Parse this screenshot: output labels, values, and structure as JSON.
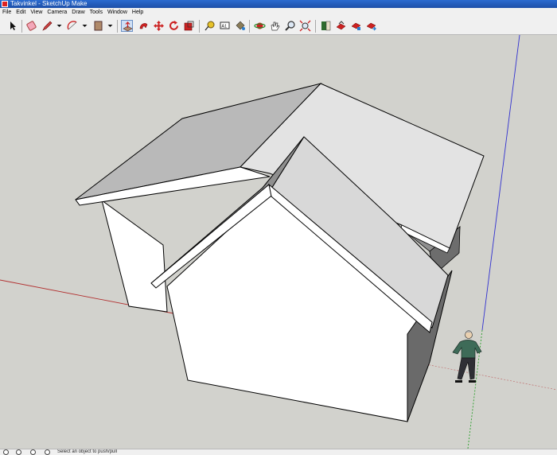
{
  "window": {
    "title": "Takvinkel - SketchUp Make"
  },
  "menu": [
    "File",
    "Edit",
    "View",
    "Camera",
    "Draw",
    "Tools",
    "Window",
    "Help"
  ],
  "toolbar": {
    "tools": [
      {
        "name": "select",
        "icon": "arrow-icon",
        "selected": false
      },
      {
        "name": "eraser",
        "icon": "eraser-icon",
        "selected": false
      },
      {
        "name": "pencil",
        "icon": "pencil-icon",
        "selected": false
      },
      {
        "name": "arc",
        "icon": "arc-icon",
        "selected": false
      },
      {
        "name": "rectangle",
        "icon": "rectangle-icon",
        "selected": false
      },
      {
        "name": "push-pull",
        "icon": "push-pull-icon",
        "selected": true
      },
      {
        "name": "follow-me",
        "icon": "follow-me-icon",
        "selected": false
      },
      {
        "name": "move",
        "icon": "move-icon",
        "selected": false
      },
      {
        "name": "rotate",
        "icon": "rotate-icon",
        "selected": false
      },
      {
        "name": "scale",
        "icon": "scale-icon",
        "selected": false
      },
      {
        "name": "tape-measure",
        "icon": "tape-measure-icon",
        "selected": false
      },
      {
        "name": "text",
        "icon": "text-icon",
        "selected": false
      },
      {
        "name": "paint-bucket",
        "icon": "paint-bucket-icon",
        "selected": false
      },
      {
        "name": "orbit",
        "icon": "orbit-icon",
        "selected": false
      },
      {
        "name": "pan",
        "icon": "pan-icon",
        "selected": false
      },
      {
        "name": "zoom",
        "icon": "zoom-icon",
        "selected": false
      },
      {
        "name": "zoom-extents",
        "icon": "zoom-extents-icon",
        "selected": false
      },
      {
        "name": "warehouse",
        "icon": "warehouse-icon",
        "selected": false
      },
      {
        "name": "share-model",
        "icon": "share-model-icon",
        "selected": false
      },
      {
        "name": "extension-warehouse",
        "icon": "extension-warehouse-icon",
        "selected": false
      },
      {
        "name": "send-to-layout",
        "icon": "send-to-layout-icon",
        "selected": false
      }
    ],
    "text_tool_glyph": "A1"
  },
  "colors": {
    "viewport_bg": "#d2d2cd",
    "red_axis": "#b23030",
    "green_axis": "#2ca02c",
    "blue_axis": "#3030d0",
    "roof_left": "#b9b9b9",
    "roof_right": "#e3e3e3",
    "wall": "#ffffff",
    "wall_shadow": "#6a6a6a"
  },
  "status": {
    "text": "Select an object to push/pull"
  }
}
